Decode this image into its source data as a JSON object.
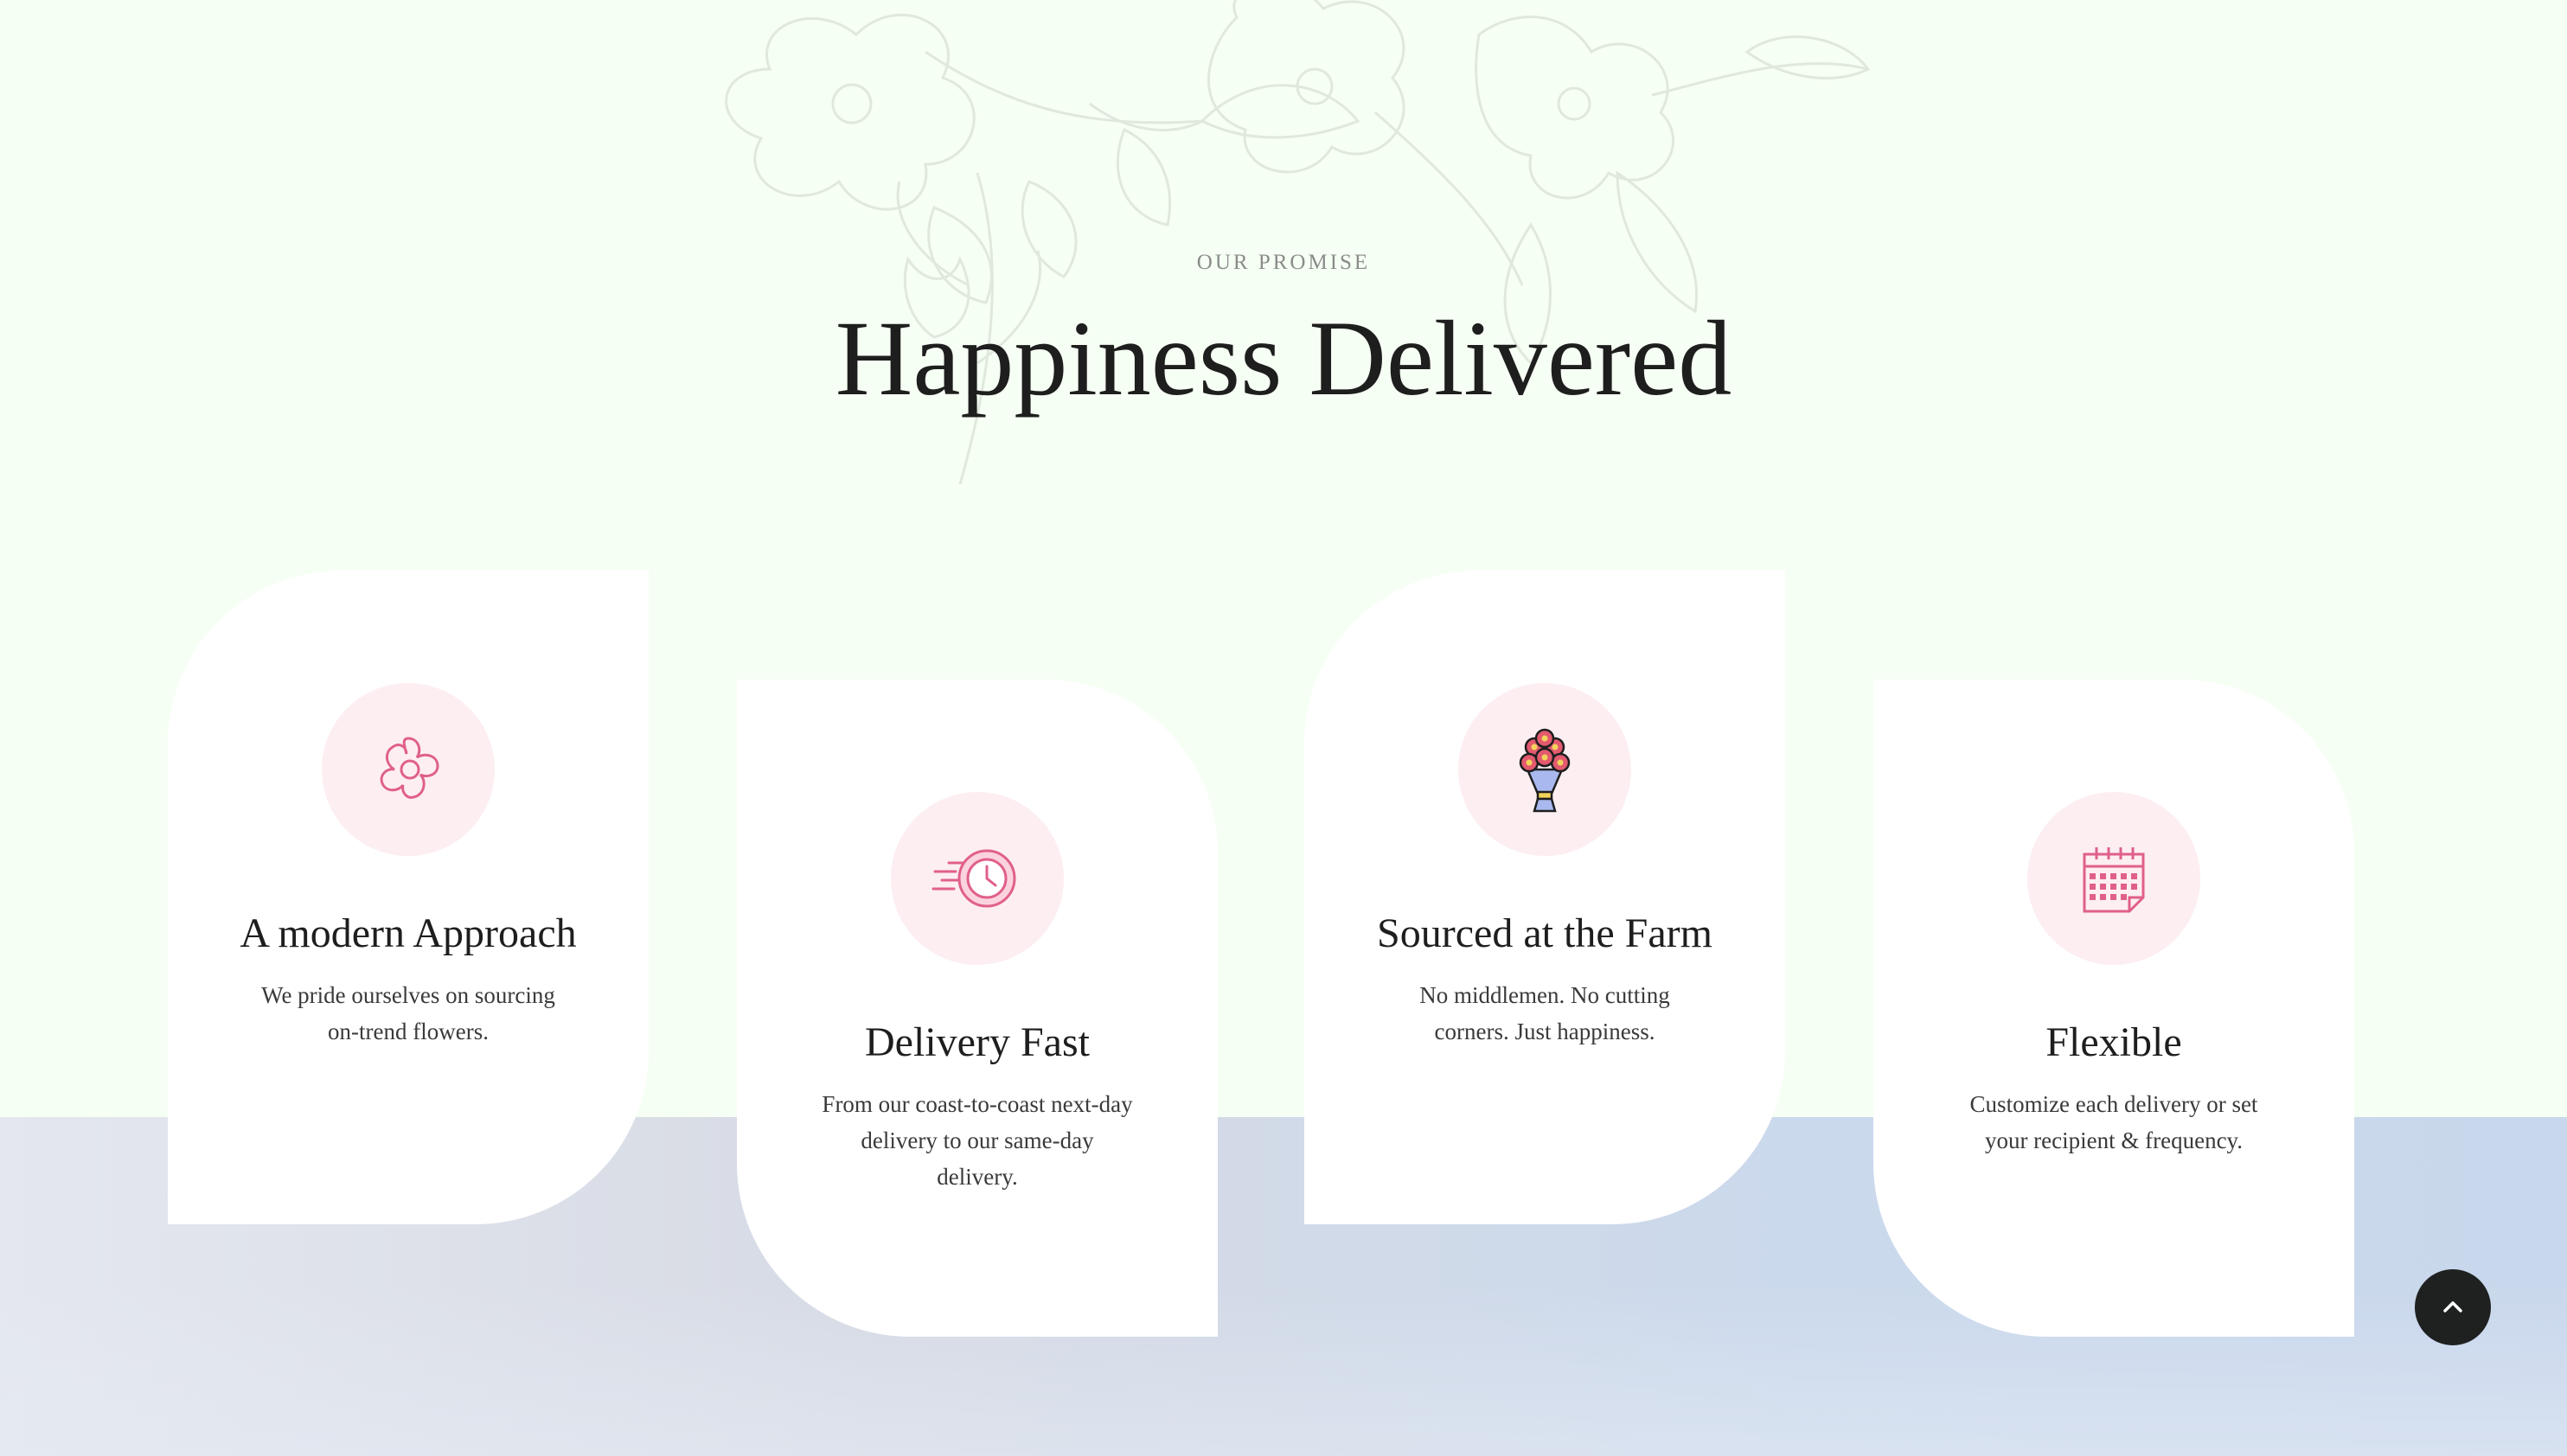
{
  "section": {
    "eyebrow": "OUR PROMISE",
    "heading": "Happiness Delivered"
  },
  "cards": [
    {
      "title": "A modern Approach",
      "text": "We pride ourselves on sourcing on-trend flowers.",
      "icon": "flower-icon"
    },
    {
      "title": "Delivery Fast",
      "text": "From our coast-to-coast next-day delivery to our same-day delivery.",
      "icon": "fast-clock-icon"
    },
    {
      "title": "Sourced at the Farm",
      "text": "No middlemen. No cutting corners. Just happiness.",
      "icon": "bouquet-icon"
    },
    {
      "title": "Flexible",
      "text": "Customize each delivery or set your recipient & frequency.",
      "icon": "calendar-icon"
    }
  ],
  "colors": {
    "top_background": "#f6fff4",
    "icon_circle": "#fdeef2",
    "accent_pink": "#e0608a",
    "dark_button": "#1f2121"
  },
  "scroll_top": {
    "icon": "chevron-up-icon"
  }
}
